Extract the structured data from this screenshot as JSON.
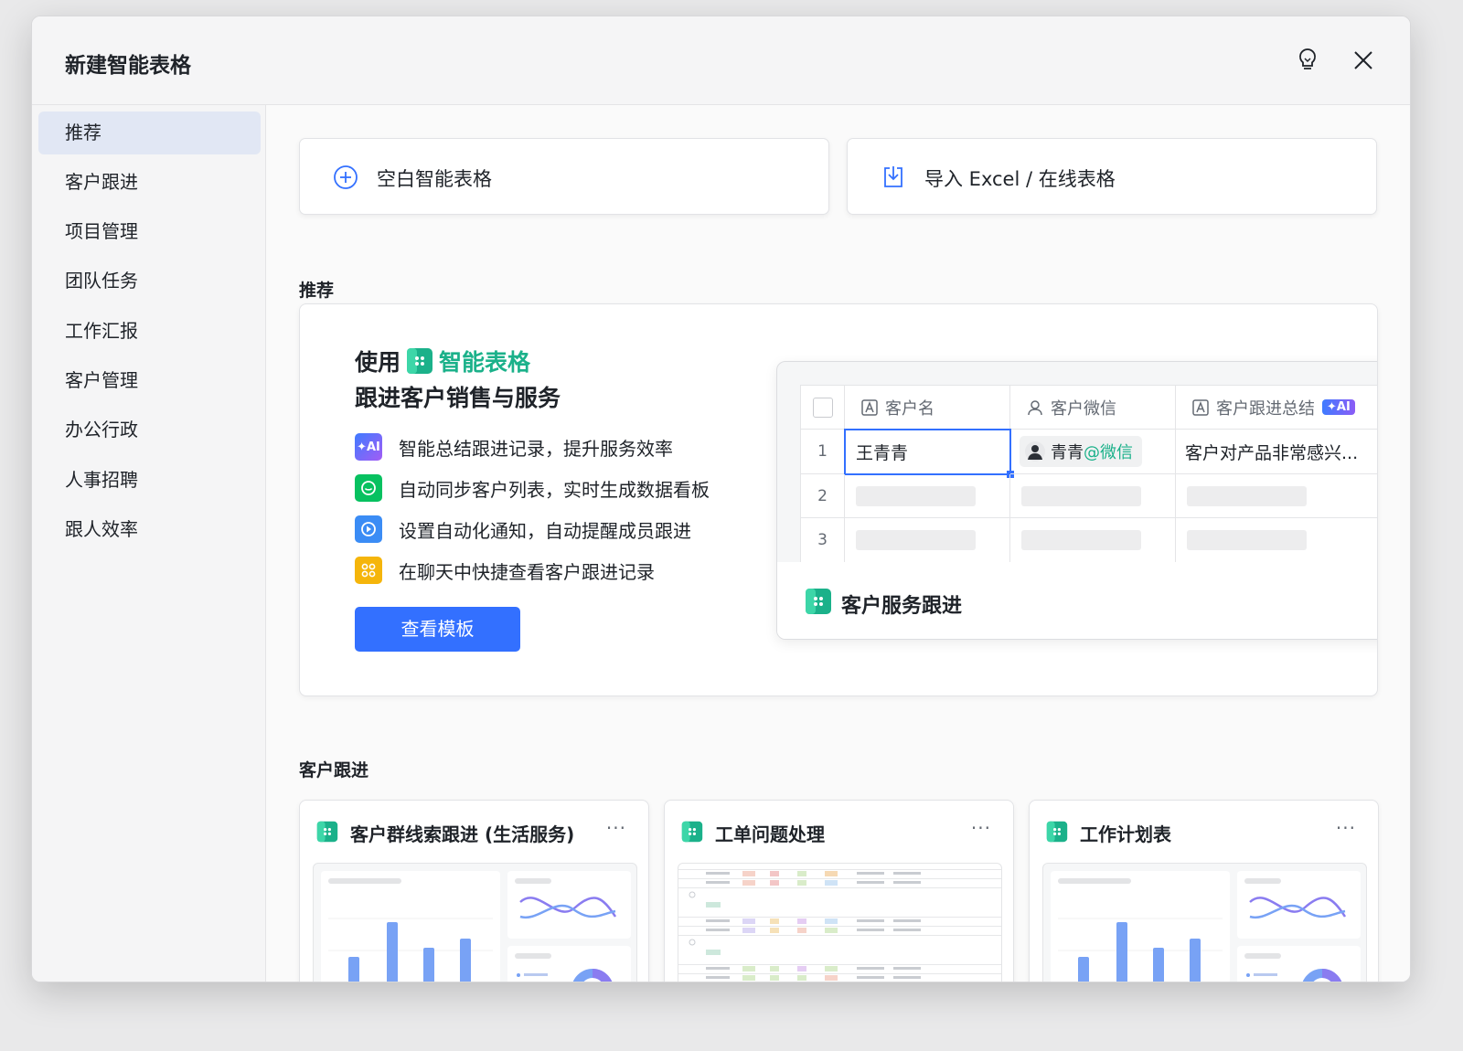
{
  "window": {
    "title": "新建智能表格"
  },
  "sidebar": {
    "items": [
      {
        "label": "推荐",
        "active": true
      },
      {
        "label": "客户跟进"
      },
      {
        "label": "项目管理"
      },
      {
        "label": "团队任务"
      },
      {
        "label": "工作汇报"
      },
      {
        "label": "客户管理"
      },
      {
        "label": "办公行政"
      },
      {
        "label": "人事招聘"
      },
      {
        "label": "跟人效率"
      }
    ]
  },
  "actions": {
    "blank_label": "空白智能表格",
    "import_label": "导入 Excel / 在线表格"
  },
  "recommend": {
    "section_title": "推荐",
    "headline_prefix": "使用",
    "headline_brand": "智能表格",
    "headline_line2": "跟进客户销售与服务",
    "features": [
      {
        "text": "智能总结跟进记录，提升服务效率",
        "icon": "ai-icon",
        "color": "#5b6cf9"
      },
      {
        "text": "自动同步客户列表，实时生成数据看板",
        "icon": "wechat-icon",
        "color": "#07c160"
      },
      {
        "text": "设置自动化通知，自动提醒成员跟进",
        "icon": "automation-icon",
        "color": "#3b8cf5"
      },
      {
        "text": "在聊天中快捷查看客户跟进记录",
        "icon": "chat-record-icon",
        "color": "#f5b50b"
      }
    ],
    "button_label": "查看模板",
    "preview": {
      "columns": [
        "客户名",
        "客户微信",
        "客户跟进总结"
      ],
      "ai_badge": "AI",
      "row_numbers": [
        "1",
        "2",
        "3"
      ],
      "row1": {
        "name": "王青青",
        "wechat_name": "青青",
        "wechat_suffix": "@微信",
        "summary": "客户对产品非常感兴..."
      },
      "footer_title": "客户服务跟进"
    }
  },
  "customer_follow": {
    "section_title": "客户跟进",
    "templates": [
      {
        "title": "客户群线索跟进 (生活服务)",
        "more": "···"
      },
      {
        "title": "工单问题处理",
        "more": "···"
      },
      {
        "title": "工作计划表",
        "more": "···"
      }
    ]
  },
  "colors": {
    "accent": "#3370ff",
    "brand": "#1bb18a",
    "active_bg": "#e1e7f4"
  }
}
